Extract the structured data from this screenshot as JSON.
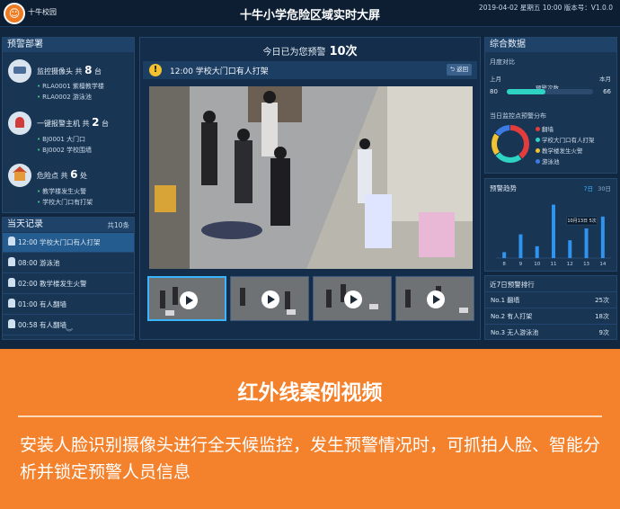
{
  "header": {
    "logo_glyph": "☺",
    "brand": "十牛校园",
    "title": "十牛小学危险区域实时大屏",
    "datetime": "2019-04-02 星期五 10:00 版本号：V1.0.0"
  },
  "deploy": {
    "title": "预警部署",
    "groups": [
      {
        "icon": "camera-icon",
        "label": "监控摄像头 共",
        "count": "8",
        "unit": "台",
        "lines": [
          "RLA0001 紫檀教学楼",
          "RLA0002 游泳池"
        ]
      },
      {
        "icon": "alarm-icon",
        "label": "一键报警主机 共",
        "count": "2",
        "unit": "台",
        "lines": [
          "BJ0001 大门口",
          "BJ0002 学校围墙"
        ]
      },
      {
        "icon": "school-icon",
        "label": "危险点 共",
        "count": "6",
        "unit": "处",
        "lines": [
          "教学楼发生火警",
          "学校大门口有打架"
        ]
      }
    ]
  },
  "records": {
    "title": "当天记录",
    "count": "共10条",
    "items": [
      {
        "text": "12:00 学校大门口有人打架",
        "active": true
      },
      {
        "text": "08:00 游泳池",
        "active": false
      },
      {
        "text": "02:00 教学楼发生火警",
        "active": false
      },
      {
        "text": "01:00 有人翻墙",
        "active": false
      },
      {
        "text": "00:58 有人翻墙",
        "active": false
      }
    ],
    "more_glyph": "︾"
  },
  "center": {
    "today_label": "今日已为您预警",
    "today_count": "10次",
    "alert_icon": "!",
    "alert_text": "12:00   学校大门口有人打架",
    "back_label": "⮌ 返回",
    "view_label_1": "查看",
    "view_label_2": "实时"
  },
  "stats": {
    "title": "综合数据",
    "compare_label": "月度对比",
    "last_year": "上月",
    "this_year": "本月",
    "mid_label": "预警次数",
    "left_num": "80",
    "right_num": "66",
    "compare_fraction": 0.45,
    "dist_label": "当日监控点预警分布",
    "distribution": [
      {
        "name": "翻墙",
        "color": "#e23c3c",
        "value": 40
      },
      {
        "name": "学校大门口有人打架",
        "color": "#2ed3c4",
        "value": 25
      },
      {
        "name": "教学楼发生火警",
        "color": "#f2c230",
        "value": 20
      },
      {
        "name": "游泳池",
        "color": "#3c7be2",
        "value": 15
      }
    ]
  },
  "trend": {
    "title": "预警趋势",
    "tab_day": "7日",
    "tab_month": "30日",
    "tooltip": "10月13日 5次"
  },
  "rank": {
    "title": "近7日预警排行",
    "rows": [
      {
        "name": "No.1  翻墙",
        "value": "25次"
      },
      {
        "name": "No.2  有人打架",
        "value": "18次"
      },
      {
        "name": "No.3  无人游泳池",
        "value": "9次"
      }
    ]
  },
  "chart_data": {
    "type": "bar",
    "categories": [
      "8",
      "9",
      "10",
      "11",
      "12",
      "13",
      "14"
    ],
    "values": [
      1,
      4,
      2,
      9,
      3,
      5,
      7
    ],
    "title": "预警趋势",
    "xlabel": "",
    "ylabel": "",
    "ylim": [
      0,
      10
    ],
    "grid": false
  },
  "caption": {
    "title": "红外线案例视频",
    "body": "安装人脸识别摄像头进行全天候监控，发生预警情况时，可抓拍人脸、智能分析并锁定预警人员信息"
  },
  "colors": {
    "accent": "#f4812b",
    "panel": "#183554",
    "highlight": "#39b6ff"
  }
}
